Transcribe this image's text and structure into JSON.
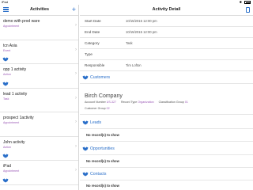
{
  "status_bar": {
    "carrier": "iPad",
    "time": "",
    "bluetooth": "✱"
  },
  "activities_pane": {
    "title": "Activities",
    "items": [
      {
        "name": "demo with prod ware",
        "type": "Appointment",
        "has_handshake": false
      },
      {
        "name": "tcn Asia",
        "type": "Event",
        "has_handshake": true
      },
      {
        "name": "opp 1 activity",
        "type": "Action",
        "has_handshake": true
      },
      {
        "name": "lead 1 activity",
        "type": "Task",
        "has_handshake": false
      },
      {
        "name": "prospect 1activity",
        "type": "Appointment",
        "has_handshake": false
      },
      {
        "name": "John activity",
        "type": "Action",
        "has_handshake": true
      },
      {
        "name": "iPad",
        "type": "Appointment",
        "has_handshake": true
      }
    ]
  },
  "detail_pane": {
    "title": "Activity Detail",
    "fields": [
      {
        "label": "Start Date",
        "value": "10/15/2015 12:00 pm"
      },
      {
        "label": "End Date",
        "value": "10/15/2015 12:00 pm"
      },
      {
        "label": "Category",
        "value": "Task"
      },
      {
        "label": "Type",
        "value": ""
      },
      {
        "label": "Responsible",
        "value": "Tim Lofton"
      }
    ],
    "customers": {
      "label": "Customers",
      "company": "Birch Company",
      "account_number_label": "Account Number",
      "account_number": "US-327",
      "record_type_label": "Record Type",
      "record_type": "Organization",
      "classification_group_label": "Classification Group",
      "classification_group": "01",
      "customer_group_label": "Customer Group",
      "customer_group": "02"
    },
    "leads": {
      "label": "Leads",
      "empty": "No record(s) to show"
    },
    "opportunities": {
      "label": "Opportunities",
      "empty": "No record(s) to show"
    },
    "contacts": {
      "label": "Contacts",
      "empty": "No record(s) to show"
    }
  },
  "colors": {
    "accent": "#2a6fc9",
    "purple": "#9b59b6"
  }
}
